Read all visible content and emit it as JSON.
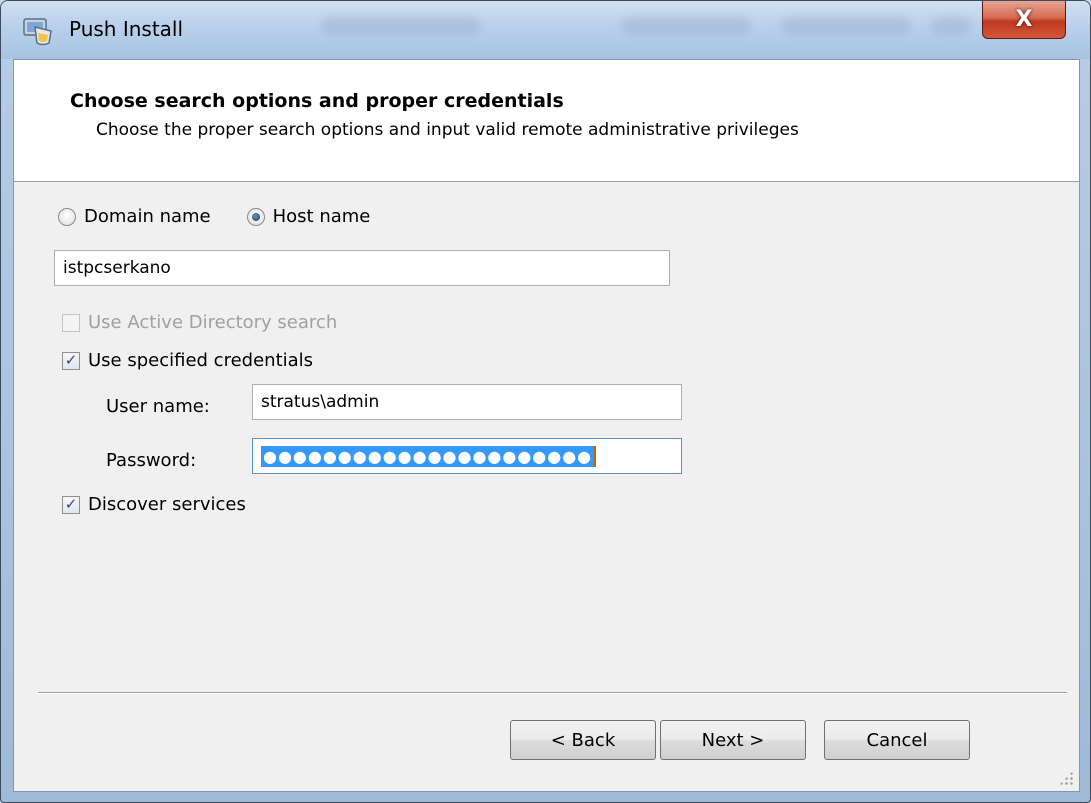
{
  "window": {
    "title": "Push Install",
    "close_glyph": "X"
  },
  "header": {
    "title": "Choose search options and proper credentials",
    "subtitle": "Choose the proper search options and input valid remote administrative privileges"
  },
  "search_mode": {
    "options": [
      "Domain name",
      "Host name"
    ],
    "selected": "Host name"
  },
  "hostname": {
    "value": "istpcserkano"
  },
  "options": {
    "active_directory": {
      "label": "Use Active Directory search",
      "checked": false,
      "enabled": false
    },
    "specified_credentials": {
      "label": "Use specified credentials",
      "checked": true,
      "enabled": true
    },
    "discover_services": {
      "label": "Discover services",
      "checked": true,
      "enabled": true
    }
  },
  "credentials": {
    "username_label": "User name:",
    "username_value": "stratus\\admin",
    "password_label": "Password:",
    "password_mask": "●●●●●●●●●●●●●●●●●●●●●●"
  },
  "buttons": {
    "back": "< Back",
    "next": "Next >",
    "cancel": "Cancel"
  },
  "icons": {
    "app": "shield-monitor-icon",
    "check": "✓"
  }
}
